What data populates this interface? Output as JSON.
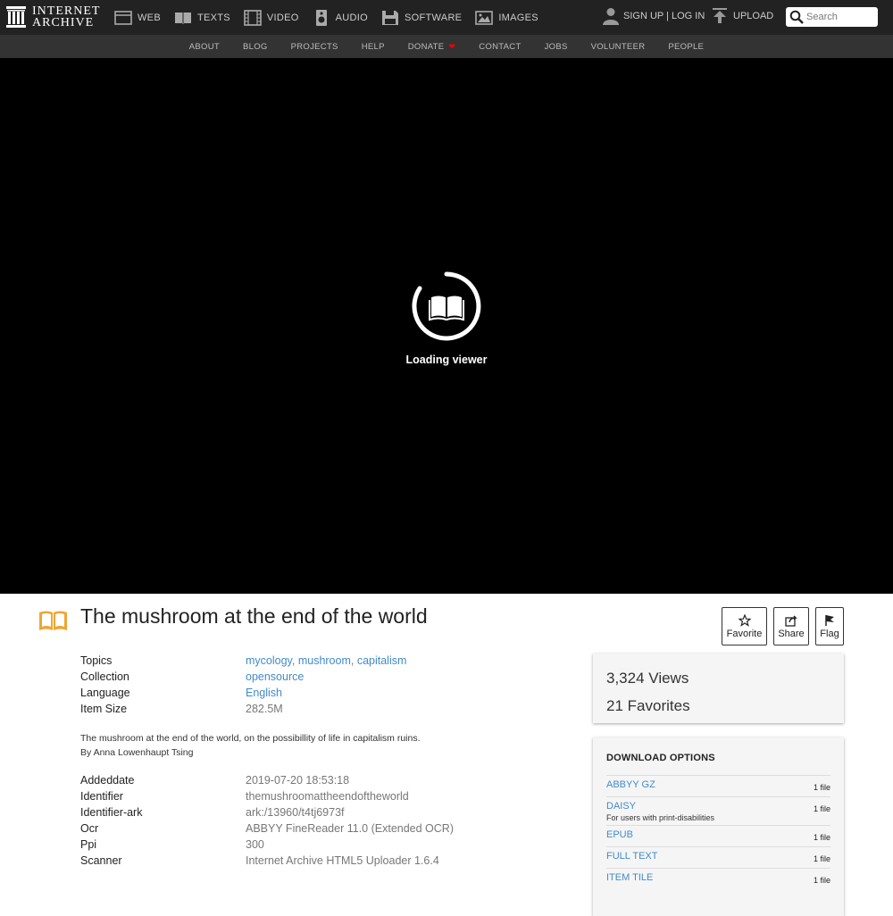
{
  "logo": {
    "line1": "INTERNET",
    "line2": "ARCHIVE"
  },
  "nav": [
    {
      "label": "WEB",
      "icon": "web-icon"
    },
    {
      "label": "TEXTS",
      "icon": "texts-icon"
    },
    {
      "label": "VIDEO",
      "icon": "video-icon"
    },
    {
      "label": "AUDIO",
      "icon": "audio-icon"
    },
    {
      "label": "SOFTWARE",
      "icon": "software-icon"
    },
    {
      "label": "IMAGES",
      "icon": "images-icon"
    }
  ],
  "account": {
    "label": "SIGN UP | LOG IN"
  },
  "upload": {
    "label": "UPLOAD"
  },
  "search": {
    "placeholder": "Search"
  },
  "subnav": [
    "ABOUT",
    "BLOG",
    "PROJECTS",
    "HELP",
    "DONATE",
    "CONTACT",
    "JOBS",
    "VOLUNTEER",
    "PEOPLE"
  ],
  "viewer": {
    "loading": "Loading viewer"
  },
  "item": {
    "title": "The mushroom at the end of the world",
    "actions": {
      "favorite": "Favorite",
      "share": "Share",
      "flag": "Flag"
    },
    "meta_top": [
      {
        "key": "Topics",
        "links": [
          "mycology",
          "mushroom",
          "capitalism"
        ]
      },
      {
        "key": "Collection",
        "links": [
          "opensource"
        ]
      },
      {
        "key": "Language",
        "links": [
          "English"
        ]
      },
      {
        "key": "Item Size",
        "value": "282.5M"
      }
    ],
    "description": [
      "The mushroom at the end of the world, on the possibillity of life in capitalism ruins.",
      "By Anna Lowenhaupt Tsing"
    ],
    "meta_bottom": [
      {
        "key": "Addeddate",
        "value": "2019-07-20 18:53:18"
      },
      {
        "key": "Identifier",
        "value": "themushroomattheendoftheworld"
      },
      {
        "key": "Identifier-ark",
        "value": "ark:/13960/t4tj6973f"
      },
      {
        "key": "Ocr",
        "value": "ABBYY FineReader 11.0 (Extended OCR)"
      },
      {
        "key": "Ppi",
        "value": "300"
      },
      {
        "key": "Scanner",
        "value": "Internet Archive HTML5 Uploader 1.6.4"
      }
    ]
  },
  "stats": {
    "views_num": "3,324",
    "views_label": "Views",
    "favs_num": "21",
    "favs_label": "Favorites"
  },
  "downloads": {
    "heading": "DOWNLOAD OPTIONS",
    "items": [
      {
        "name": "ABBYY GZ",
        "count": "1 file"
      },
      {
        "name": "DAISY",
        "sub": "For users with print-disabilities",
        "count": "1 file"
      },
      {
        "name": "EPUB",
        "count": "1 file"
      },
      {
        "name": "FULL TEXT",
        "count": "1 file"
      },
      {
        "name": "ITEM TILE",
        "count": "1 file"
      }
    ]
  },
  "colors": {
    "link": "#428bca",
    "topbar": "#222222",
    "subnav": "#333333",
    "heart": "#ee0000",
    "book_icon": "#f0a531"
  }
}
